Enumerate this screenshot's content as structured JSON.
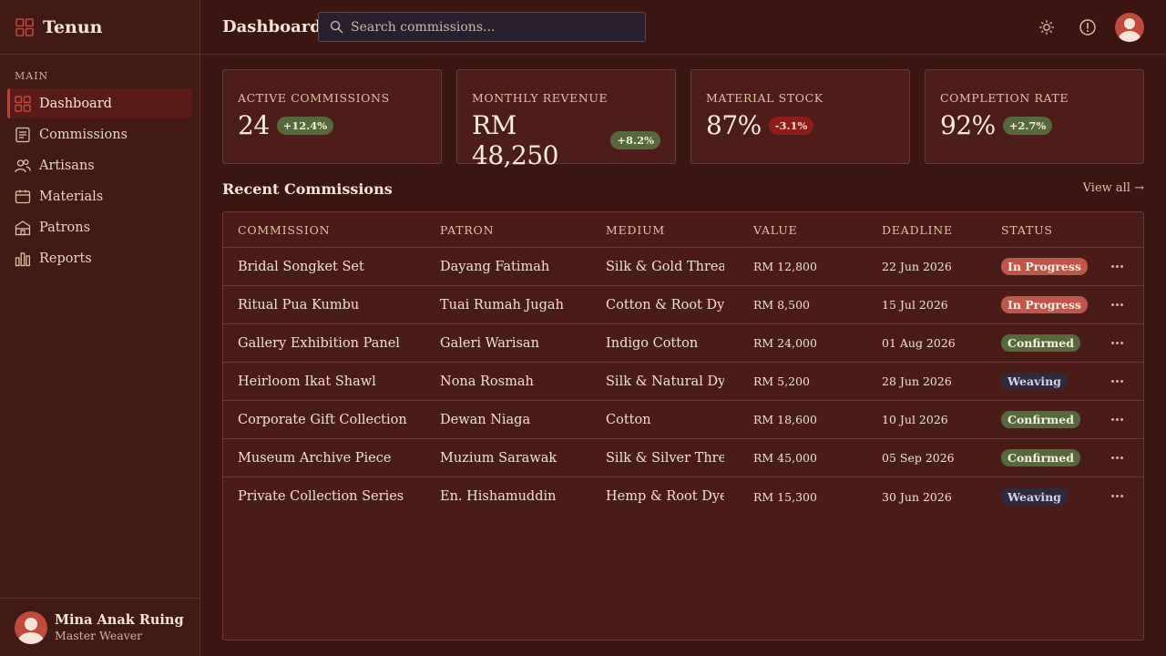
{
  "brand": {
    "name": "Tenun"
  },
  "sidebar": {
    "section_label": "MAIN",
    "items": [
      {
        "label": "Dashboard",
        "icon": "grid-icon",
        "active": true
      },
      {
        "label": "Commissions",
        "icon": "document-icon",
        "active": false
      },
      {
        "label": "Artisans",
        "icon": "users-icon",
        "active": false
      },
      {
        "label": "Materials",
        "icon": "box-icon",
        "active": false
      },
      {
        "label": "Patrons",
        "icon": "building-icon",
        "active": false
      },
      {
        "label": "Reports",
        "icon": "bar-chart-icon",
        "active": false
      }
    ]
  },
  "user": {
    "name": "Mina Anak Ruing",
    "role": "Master Weaver"
  },
  "header": {
    "title": "Dashboard",
    "search_placeholder": "Search commissions..."
  },
  "stats": [
    {
      "label": "ACTIVE COMMISSIONS",
      "value": "24",
      "delta": "+12.4%",
      "trend": "up"
    },
    {
      "label": "MONTHLY REVENUE",
      "value": "RM 48,250",
      "delta": "+8.2%",
      "trend": "up"
    },
    {
      "label": "MATERIAL STOCK",
      "value": "87%",
      "delta": "-3.1%",
      "trend": "down"
    },
    {
      "label": "COMPLETION RATE",
      "value": "92%",
      "delta": "+2.7%",
      "trend": "up"
    }
  ],
  "recent": {
    "title": "Recent Commissions",
    "view_all": "View all →",
    "columns": [
      "COMMISSION",
      "PATRON",
      "MEDIUM",
      "VALUE",
      "DEADLINE",
      "STATUS"
    ],
    "rows": [
      {
        "commission": "Bridal Songket Set",
        "patron": "Dayang Fatimah",
        "medium": "Silk & Gold Thread",
        "value": "RM 12,800",
        "deadline": "22 Jun 2026",
        "status": "In Progress"
      },
      {
        "commission": "Ritual Pua Kumbu",
        "patron": "Tuai Rumah Jugah",
        "medium": "Cotton & Root Dye",
        "value": "RM 8,500",
        "deadline": "15 Jul 2026",
        "status": "In Progress"
      },
      {
        "commission": "Gallery Exhibition Panel",
        "patron": "Galeri Warisan",
        "medium": "Indigo Cotton",
        "value": "RM 24,000",
        "deadline": "01 Aug 2026",
        "status": "Confirmed"
      },
      {
        "commission": "Heirloom Ikat Shawl",
        "patron": "Nona Rosmah",
        "medium": "Silk & Natural Dye",
        "value": "RM 5,200",
        "deadline": "28 Jun 2026",
        "status": "Weaving"
      },
      {
        "commission": "Corporate Gift Collection",
        "patron": "Dewan Niaga",
        "medium": "Cotton",
        "value": "RM 18,600",
        "deadline": "10 Jul 2026",
        "status": "Confirmed"
      },
      {
        "commission": "Museum Archive Piece",
        "patron": "Muzium Sarawak",
        "medium": "Silk & Silver Thre...",
        "value": "RM 45,000",
        "deadline": "05 Sep 2026",
        "status": "Confirmed"
      },
      {
        "commission": "Private Collection Series",
        "patron": "En. Hishamuddin",
        "medium": "Hemp & Root Dye",
        "value": "RM 15,300",
        "deadline": "30 Jun 2026",
        "status": "Weaving"
      }
    ]
  },
  "colors": {
    "background": "#3a1512",
    "accent": "#c04a3c",
    "positive": "#55693a",
    "negative": "#8c1e1a",
    "weaving": "#302a3e"
  }
}
